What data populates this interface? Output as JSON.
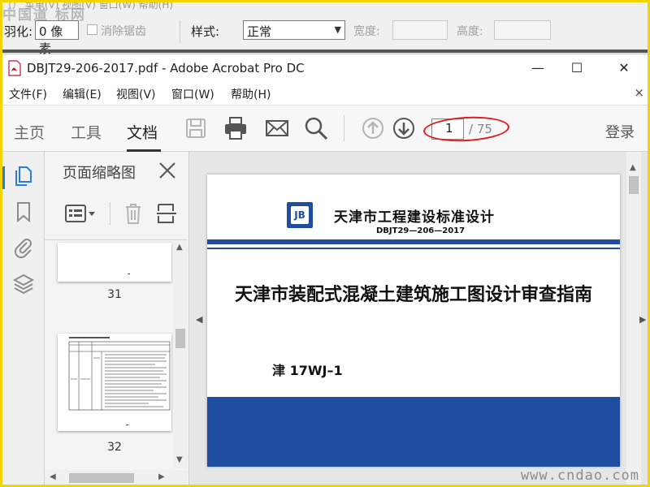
{
  "host": {
    "watermark": "中国道 标网",
    "menu_fragment": "（）  菜单(V)  视图(V)  窗口(W)  帮助(H)",
    "fields": {
      "emerge_label": "羽化:",
      "emerge_value": "0 像素",
      "antialias_label": "消除锯齿",
      "style_label": "样式:",
      "style_value": "正常",
      "width_label": "宽度:",
      "height_label": "高度:"
    }
  },
  "window": {
    "title": "DBJT29-206-2017.pdf - Adobe Acrobat Pro DC",
    "minimize": "—",
    "maximize": "☐",
    "close": "✕"
  },
  "menubar": {
    "items": [
      "文件(F)",
      "编辑(E)",
      "视图(V)",
      "窗口(W)",
      "帮助(H)"
    ],
    "close": "×"
  },
  "toolbar": {
    "tabs": [
      "主页",
      "工具",
      "文档"
    ],
    "active_tab": "文档",
    "page_current": "1",
    "page_total": "/ 75",
    "login": "登录"
  },
  "thumbnails": {
    "title": "页面缩略图",
    "pages": [
      {
        "number": "31"
      },
      {
        "number": "32"
      }
    ]
  },
  "document": {
    "institute": "天津市工程建设标准设计",
    "logo_text": "JB",
    "code": "DBJT29—206—2017",
    "title": "天津市装配式混凝土建筑施工图设计审查指南",
    "number": "津 17WJ–1"
  },
  "site_watermark": "www.cndao.com",
  "colors": {
    "frame": "#f2d400",
    "doc_blue": "#1f4da0",
    "annotation_red": "#e01b1b",
    "active_accent": "#2b7bd8"
  }
}
